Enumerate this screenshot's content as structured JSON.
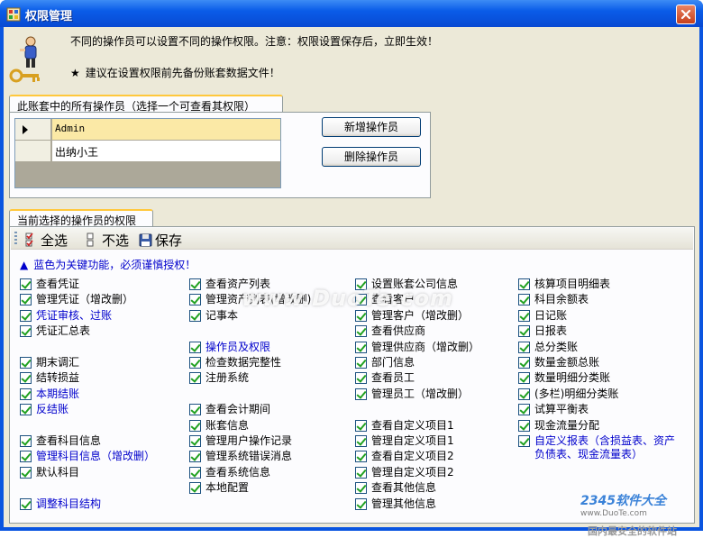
{
  "window": {
    "title": "权限管理",
    "colors": {
      "titlebar": "#0a55e0",
      "close": "#d85a36",
      "client": "#ece9d8",
      "accent_blue": "#0000cc",
      "selected_row": "#fbe9a6"
    }
  },
  "header": {
    "line1": "不同的操作员可以设置不同的操作权限。注意：权限设置保存后，立即生效！",
    "star": "★",
    "line2": "建议在设置权限前先备份账套数据文件！",
    "icon": "key-person-icon"
  },
  "operators": {
    "tab_label": "此账套中的所有操作员（选择一个可查看其权限）",
    "rows": [
      {
        "name": "Admin",
        "selected": true
      },
      {
        "name": "出纳小王",
        "selected": false
      }
    ],
    "add_button": "新增操作员",
    "delete_button": "删除操作员"
  },
  "permissions": {
    "tab_label": "当前选择的操作员的权限",
    "toolbar": {
      "select_all": "全选",
      "select_none": "不选",
      "save": "保存"
    },
    "legend_marker": "▲",
    "legend": "蓝色为关键功能，必须谨慎授权！",
    "columns": [
      [
        {
          "label": "查看凭证",
          "checked": true,
          "key": false
        },
        {
          "label": "管理凭证（增改删）",
          "checked": true,
          "key": false
        },
        {
          "label": "凭证审核、过账",
          "checked": true,
          "key": true
        },
        {
          "label": "凭证汇总表",
          "checked": true,
          "key": false
        },
        {
          "label": "",
          "spacer": true
        },
        {
          "label": "期末调汇",
          "checked": true,
          "key": false
        },
        {
          "label": "结转损益",
          "checked": true,
          "key": false
        },
        {
          "label": "本期结账",
          "checked": true,
          "key": true
        },
        {
          "label": "反结账",
          "checked": true,
          "key": true
        },
        {
          "label": "",
          "spacer": true
        },
        {
          "label": "查看科目信息",
          "checked": true,
          "key": false
        },
        {
          "label": "管理科目信息（增改删）",
          "checked": true,
          "key": true
        },
        {
          "label": "默认科目",
          "checked": true,
          "key": false
        },
        {
          "label": "",
          "spacer": true
        },
        {
          "label": "调整科目结构",
          "checked": true,
          "key": true
        }
      ],
      [
        {
          "label": "查看资产列表",
          "checked": true,
          "key": false
        },
        {
          "label": "管理资产列表(增改删)",
          "checked": true,
          "key": false
        },
        {
          "label": "记事本",
          "checked": true,
          "key": false
        },
        {
          "label": "",
          "spacer": true
        },
        {
          "label": "操作员及权限",
          "checked": true,
          "key": true
        },
        {
          "label": "检查数据完整性",
          "checked": true,
          "key": false
        },
        {
          "label": "注册系统",
          "checked": true,
          "key": false
        },
        {
          "label": "",
          "spacer": true
        },
        {
          "label": "查看会计期间",
          "checked": true,
          "key": false
        },
        {
          "label": "账套信息",
          "checked": true,
          "key": false
        },
        {
          "label": "管理用户操作记录",
          "checked": true,
          "key": false
        },
        {
          "label": "管理系统错误消息",
          "checked": true,
          "key": false
        },
        {
          "label": "查看系统信息",
          "checked": true,
          "key": false
        },
        {
          "label": "本地配置",
          "checked": true,
          "key": false
        }
      ],
      [
        {
          "label": "设置账套公司信息",
          "checked": true,
          "key": false
        },
        {
          "label": "查看客户",
          "checked": true,
          "key": false
        },
        {
          "label": "管理客户（增改删）",
          "checked": true,
          "key": false
        },
        {
          "label": "查看供应商",
          "checked": true,
          "key": false
        },
        {
          "label": "管理供应商（增改删）",
          "checked": true,
          "key": false
        },
        {
          "label": "部门信息",
          "checked": true,
          "key": false
        },
        {
          "label": "查看员工",
          "checked": true,
          "key": false
        },
        {
          "label": "管理员工（增改删）",
          "checked": true,
          "key": false
        },
        {
          "label": "",
          "spacer": true
        },
        {
          "label": "查看自定义项目1",
          "checked": true,
          "key": false
        },
        {
          "label": "管理自定义项目1",
          "checked": true,
          "key": false
        },
        {
          "label": "查看自定义项目2",
          "checked": true,
          "key": false
        },
        {
          "label": "管理自定义项目2",
          "checked": true,
          "key": false
        },
        {
          "label": "查看其他信息",
          "checked": true,
          "key": false
        },
        {
          "label": "管理其他信息",
          "checked": true,
          "key": false
        }
      ],
      [
        {
          "label": "核算项目明细表",
          "checked": true,
          "key": false
        },
        {
          "label": "科目余额表",
          "checked": true,
          "key": false
        },
        {
          "label": "日记账",
          "checked": true,
          "key": false
        },
        {
          "label": "日报表",
          "checked": true,
          "key": false
        },
        {
          "label": "总分类账",
          "checked": true,
          "key": false
        },
        {
          "label": "数量金额总账",
          "checked": true,
          "key": false
        },
        {
          "label": "数量明细分类账",
          "checked": true,
          "key": false
        },
        {
          "label": "(多栏)明细分类账",
          "checked": true,
          "key": false
        },
        {
          "label": "试算平衡表",
          "checked": true,
          "key": false
        },
        {
          "label": "现金流量分配",
          "checked": true,
          "key": false
        },
        {
          "label": "自定义报表（含损益表、资产负债表、现金流量表）",
          "checked": true,
          "key": true
        }
      ]
    ]
  },
  "watermarks": {
    "duote": "www.DuoTe.com",
    "logo": "2345软件大全",
    "url": "www.DuoTe.com",
    "slogan": "国内最安全的软件站"
  }
}
